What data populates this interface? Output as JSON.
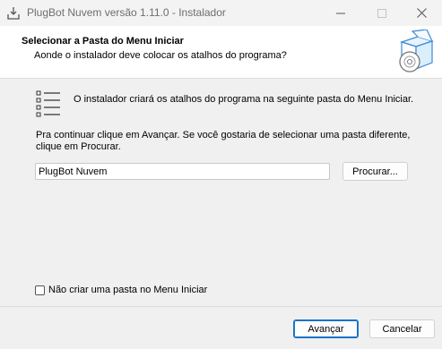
{
  "window": {
    "title": "PlugBot Nuvem versão 1.11.0 - Instalador",
    "icons": {
      "app": "installer-download-icon",
      "minimize": "minimize-icon",
      "maximize": "maximize-icon",
      "close": "close-icon"
    }
  },
  "header": {
    "title": "Selecionar a Pasta do Menu Iniciar",
    "subtitle": "Aonde o instalador deve colocar os atalhos do programa?",
    "image_icon": "setup-box-disc-icon"
  },
  "content": {
    "list_icon": "list-icon",
    "info": "O instalador criará os atalhos do programa na seguinte pasta do Menu Iniciar.",
    "instructions": "Pra continuar clique em Avançar. Se você gostaria de selecionar uma pasta diferente, clique em Procurar.",
    "folder_value": "PlugBot Nuvem",
    "browse_label": "Procurar...",
    "no_folder_label": "Não criar uma pasta no Menu Iniciar",
    "no_folder_checked": false
  },
  "footer": {
    "next_label": "Avançar",
    "cancel_label": "Cancelar"
  },
  "colors": {
    "accent": "#1a73c9",
    "background": "#f0f0f0",
    "header_bg": "#ffffff"
  }
}
